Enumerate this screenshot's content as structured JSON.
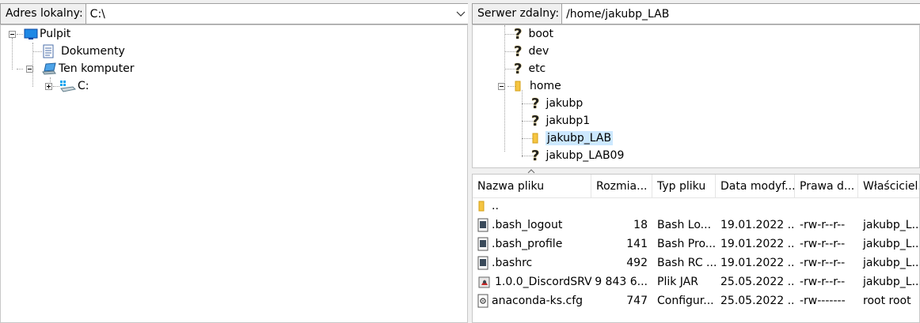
{
  "local": {
    "address_label": "Adres lokalny:",
    "address_value": "C:\\",
    "tree": [
      {
        "label": "Pulpit",
        "icon": "desktop-icon"
      },
      {
        "label": "Dokumenty",
        "icon": "document-icon"
      },
      {
        "label": "Ten komputer",
        "icon": "computer-icon"
      },
      {
        "label": "C:",
        "icon": "drive-icon"
      }
    ]
  },
  "remote": {
    "address_label": "Serwer zdalny:",
    "address_value": "/home/jakubp_LAB",
    "tree": [
      {
        "label": "boot",
        "icon": "unknown-icon"
      },
      {
        "label": "dev",
        "icon": "unknown-icon"
      },
      {
        "label": "etc",
        "icon": "unknown-icon"
      },
      {
        "label": "home",
        "icon": "folder-icon"
      },
      {
        "label": "jakubp",
        "icon": "unknown-icon"
      },
      {
        "label": "jakubp1",
        "icon": "unknown-icon"
      },
      {
        "label": "jakubp_LAB",
        "icon": "folder-icon"
      },
      {
        "label": "jakubp_LAB09",
        "icon": "unknown-icon"
      }
    ],
    "columns": [
      "Nazwa pliku",
      "Rozmia...",
      "Typ pliku",
      "Data modyf...",
      "Prawa d...",
      "Właściciel..."
    ],
    "files": [
      {
        "name": "..",
        "size": "",
        "type": "",
        "date": "",
        "perms": "",
        "owner": "",
        "icon": "folder-icon"
      },
      {
        "name": ".bash_logout",
        "size": "18",
        "type": "Bash Lo...",
        "date": "19.01.2022 ...",
        "perms": "-rw-r--r--",
        "owner": "jakubp_L...",
        "icon": "file-icon"
      },
      {
        "name": ".bash_profile",
        "size": "141",
        "type": "Bash Pro...",
        "date": "19.01.2022 ...",
        "perms": "-rw-r--r--",
        "owner": "jakubp_L...",
        "icon": "file-icon"
      },
      {
        "name": ".bashrc",
        "size": "492",
        "type": "Bash RC ...",
        "date": "19.01.2022 ...",
        "perms": "-rw-r--r--",
        "owner": "jakubp_L...",
        "icon": "file-icon"
      },
      {
        "name": "1.0.0_DiscordSRV...",
        "size": "9 843 6...",
        "type": "Plik JAR",
        "date": "25.05.2022 ...",
        "perms": "-rw-r--r--",
        "owner": "jakubp_L...",
        "icon": "jar-icon"
      },
      {
        "name": "anaconda-ks.cfg",
        "size": "747",
        "type": "Configur...",
        "date": "25.05.2022 ...",
        "perms": "-rw-------",
        "owner": "root root",
        "icon": "config-icon"
      }
    ]
  },
  "colors": {
    "folder": "#f5c542",
    "question": "#e8b400",
    "selection": "#cce8ff"
  }
}
